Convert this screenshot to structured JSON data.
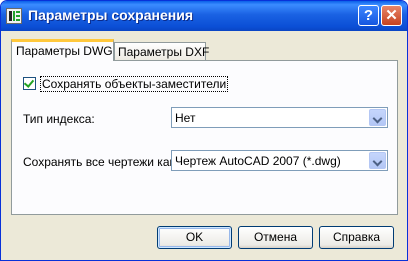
{
  "window": {
    "title": "Параметры сохранения",
    "help_glyph": "?",
    "close_glyph": "✕"
  },
  "tabs": [
    {
      "label": "Параметры DWG",
      "active": true
    },
    {
      "label": "Параметры DXF",
      "active": false
    }
  ],
  "dwg": {
    "proxy_checkbox": {
      "label": "Сохранять объекты-заместители",
      "checked": true
    },
    "index_type": {
      "label": "Тип индекса:",
      "value": "Нет"
    },
    "save_as": {
      "label": "Сохранять все чертежи как:",
      "value": "Чертеж AutoCAD 2007 (*.dwg)"
    }
  },
  "buttons": {
    "ok": "OK",
    "cancel": "Отмена",
    "help": "Справка"
  },
  "colors": {
    "titlebar": "#0b4fd6",
    "dialog_bg": "#ece9d8",
    "tab_highlight": "#ffc83c",
    "check_mark": "#21a121"
  },
  "icons": [
    "autocad-app-icon",
    "help-icon",
    "close-icon",
    "checkmark-icon",
    "dropdown-arrow-icon"
  ]
}
